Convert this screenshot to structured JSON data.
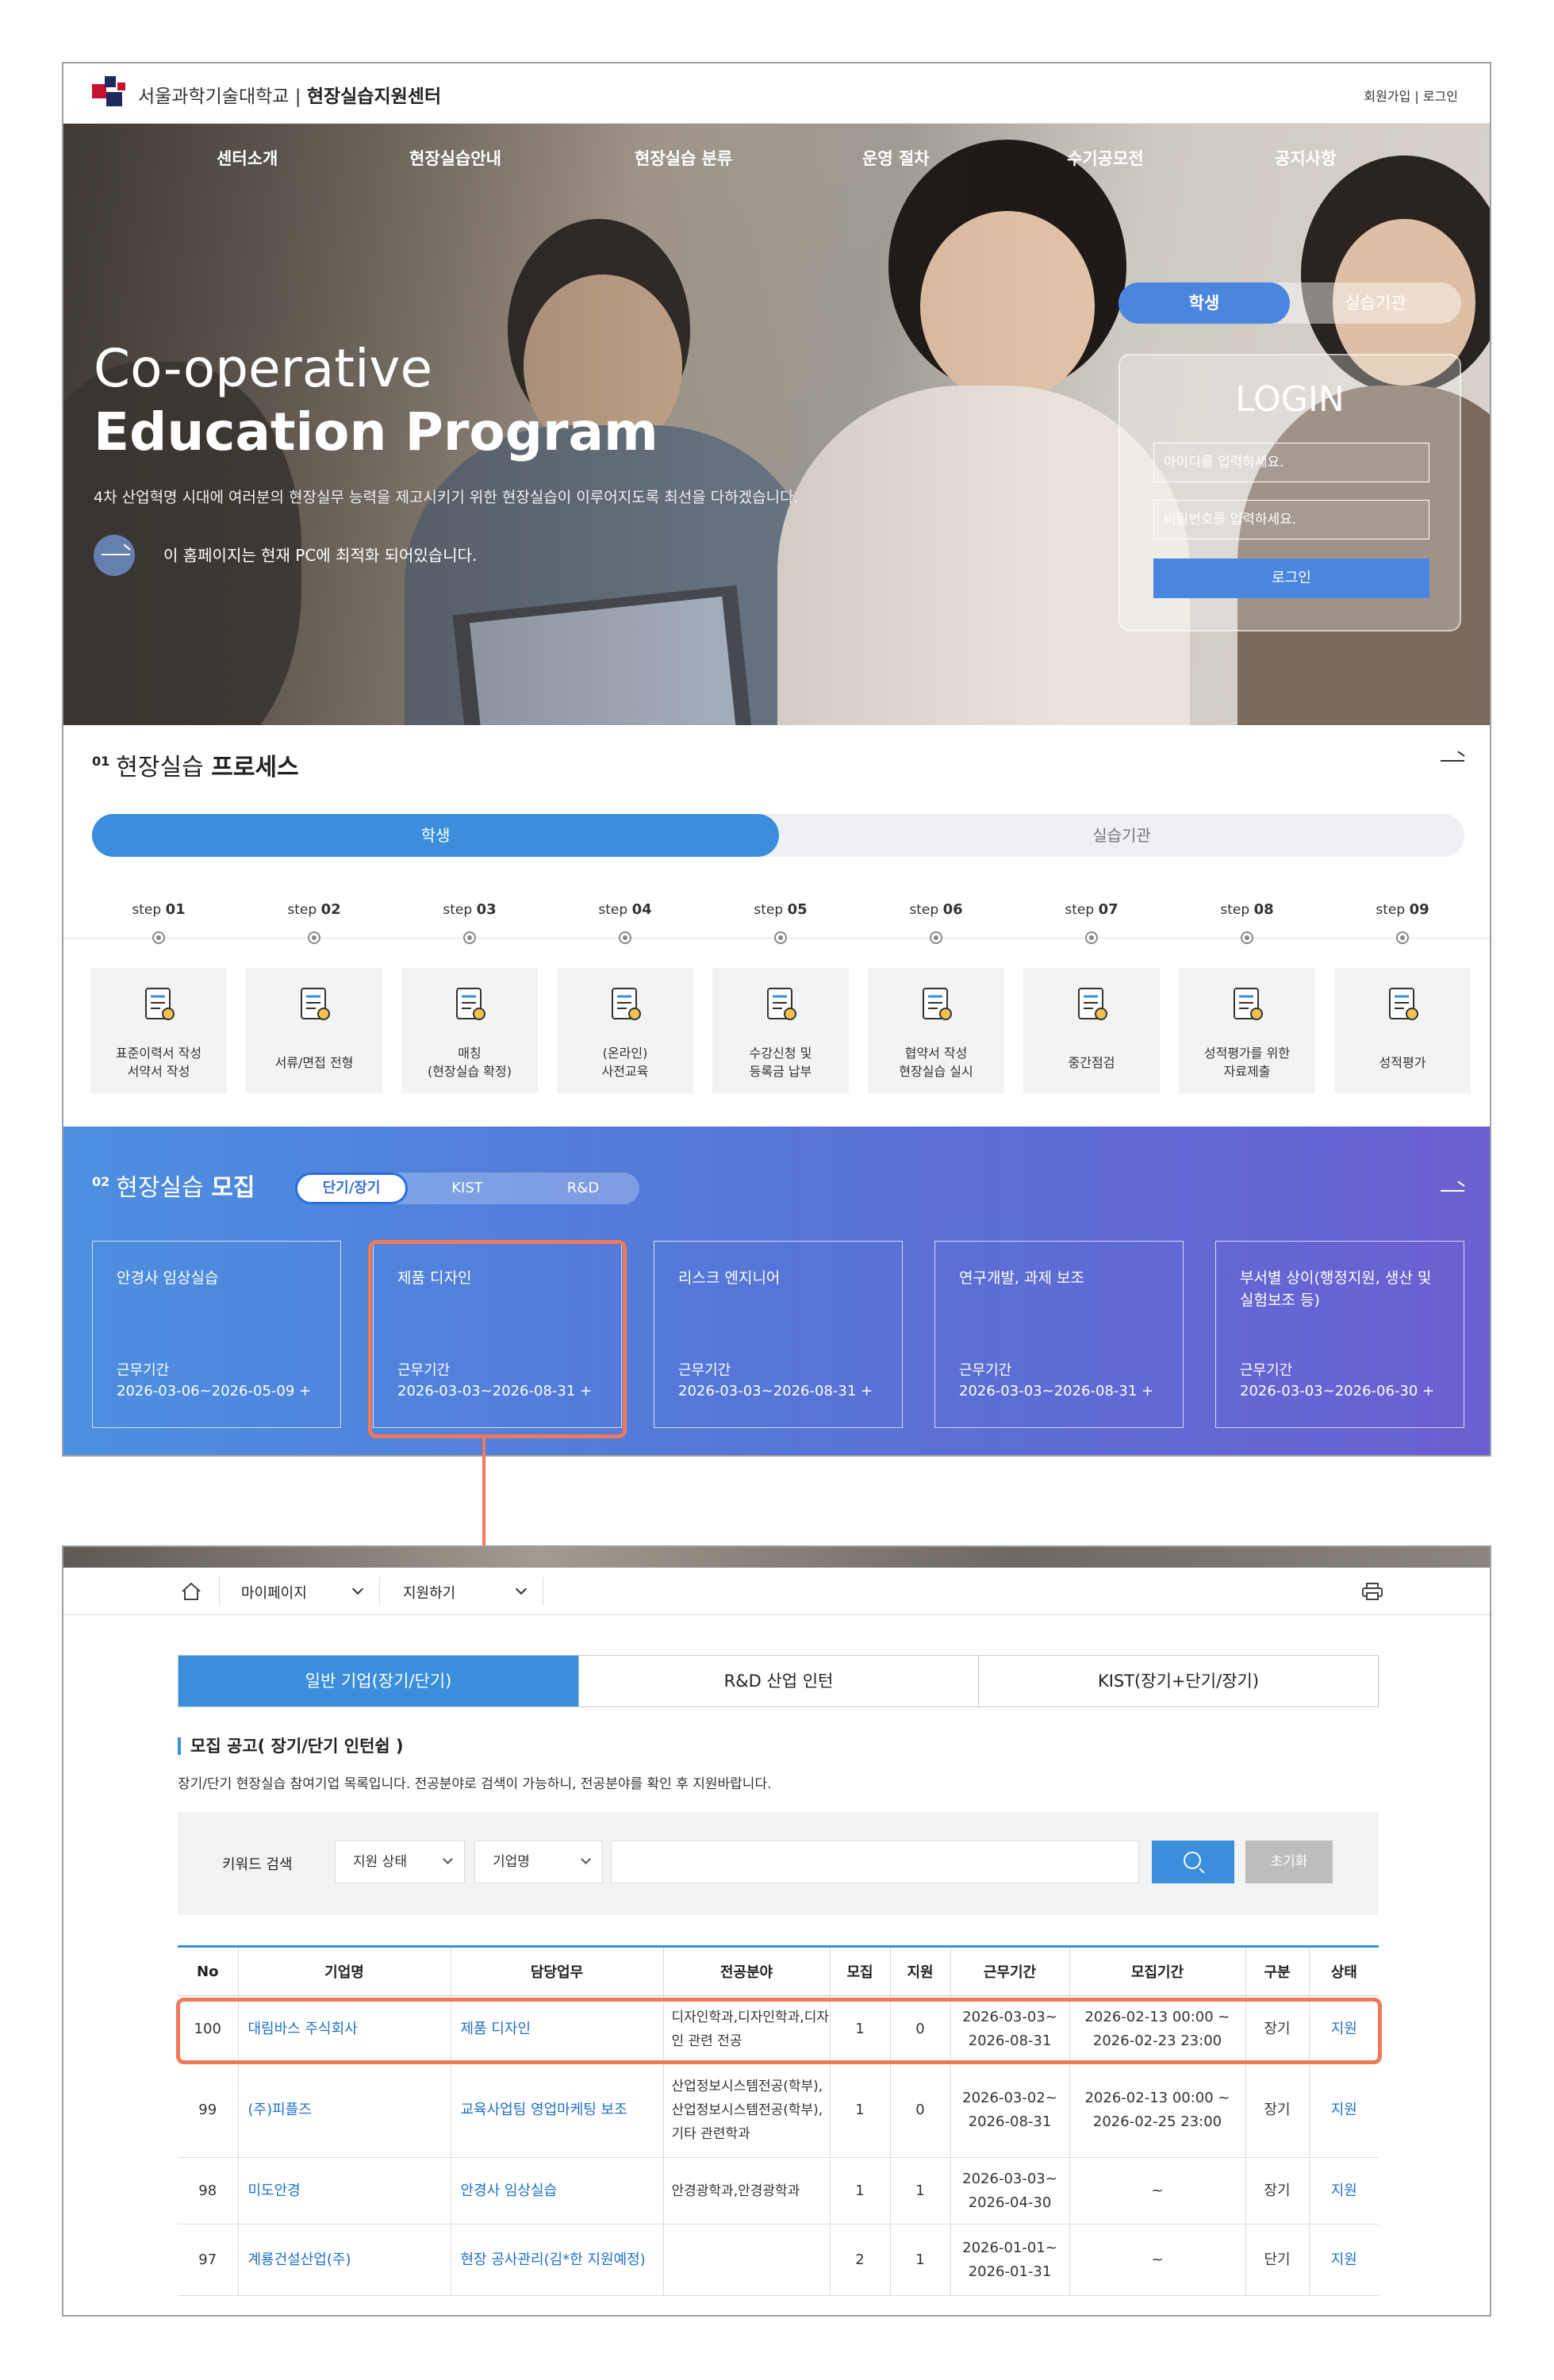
{
  "header": {
    "univ": "서울과학기술대학교",
    "center": "현장실습지원센터",
    "links": "회원가입 | 로그인"
  },
  "nav": [
    "센터소개",
    "현장실습안내",
    "현장실습 분류",
    "운영 절차",
    "수기공모전",
    "공지사항"
  ],
  "hero": {
    "title_line1": "Co-operative",
    "title_line2": "Education Program",
    "subtitle": "4차 산업혁명 시대에 여러분의 현장실무 능력을 제고시키기 위한 현장실습이 이루어지도록 최선을 다하겠습니다.",
    "note": "이 홈페이지는 현재 PC에 최적화 되어있습니다."
  },
  "login": {
    "tab_student": "학생",
    "tab_org": "실습기관",
    "title": "LOGIN",
    "id_placeholder": "아이디를 입력하세요.",
    "pw_placeholder": "비밀번호를 입력하세요.",
    "button": "로그인"
  },
  "process": {
    "num": "01",
    "title_light": "현장실습",
    "title_bold": "프로세스",
    "tab_student": "학생",
    "tab_org": "실습기관",
    "steps": [
      {
        "prefix": "step",
        "n": "01",
        "label1": "표준이력서 작성",
        "label2": "서약서 작성"
      },
      {
        "prefix": "step",
        "n": "02",
        "label1": "서류/면접 전형",
        "label2": ""
      },
      {
        "prefix": "step",
        "n": "03",
        "label1": "매칭",
        "label2": "(현장실습 확정)"
      },
      {
        "prefix": "step",
        "n": "04",
        "label1": "(온라인)",
        "label2": "사전교육"
      },
      {
        "prefix": "step",
        "n": "05",
        "label1": "수강신청 및",
        "label2": "등록금 납부"
      },
      {
        "prefix": "step",
        "n": "06",
        "label1": "협약서 작성",
        "label2": "현장실습 실시"
      },
      {
        "prefix": "step",
        "n": "07",
        "label1": "중간점검",
        "label2": ""
      },
      {
        "prefix": "step",
        "n": "08",
        "label1": "성적평가를 위한",
        "label2": "자료제출"
      },
      {
        "prefix": "step",
        "n": "09",
        "label1": "성적평가",
        "label2": ""
      }
    ]
  },
  "recruit": {
    "num": "02",
    "title_light": "현장실습",
    "title_bold": "모집",
    "tabs": [
      "단기/장기",
      "KIST",
      "R&D"
    ],
    "cards": [
      {
        "title": "안경사 임상실습",
        "period_label": "근무기간",
        "period": "2026-03-06~2026-05-09  +"
      },
      {
        "title": "제품 디자인",
        "period_label": "근무기간",
        "period": "2026-03-03~2026-08-31  +"
      },
      {
        "title": "리스크 엔지니어",
        "period_label": "근무기간",
        "period": "2026-03-03~2026-08-31  +"
      },
      {
        "title": "연구개발, 과제 보조",
        "period_label": "근무기간",
        "period": "2026-03-03~2026-08-31  +"
      },
      {
        "title": "부서별 상이(행정지원, 생산 및 실험보조 등)",
        "period_label": "근무기간",
        "period": "2026-03-03~2026-06-30  +"
      }
    ]
  },
  "page2": {
    "breadcrumb": [
      "마이페이지",
      "지원하기"
    ],
    "tabs": [
      "일반 기업(장기/단기)",
      "R&D 산업 인턴",
      "KIST(장기+단기/장기)"
    ],
    "section_title": "모집 공고( 장기/단기 인턴쉽 )",
    "section_desc": "장기/단기 현장실습 참여기업 목록입니다. 전공분야로 검색이 가능하니, 전공분야를 확인 후 지원바랍니다.",
    "search_label": "키워드 검색",
    "select_status": "지원 상태",
    "select_field": "기업명",
    "reset": "초기화",
    "columns": [
      "No",
      "기업명",
      "담당업무",
      "전공분야",
      "모집",
      "지원",
      "근무기간",
      "모집기간",
      "구분",
      "상태"
    ],
    "rows": [
      {
        "no": "100",
        "company": "대림바스 주식회사",
        "duty": "제품 디자인",
        "major": "디자인학과,디자인학과,디자인 관련 전공",
        "recruit": "1",
        "applied": "0",
        "work": "2026-03-03~ 2026-08-31",
        "period": "2026-02-13 00:00 ~ 2026-02-23 23:00",
        "type": "장기",
        "status": "지원"
      },
      {
        "no": "99",
        "company": "(주)피플즈",
        "duty": "교육사업팀 영업마케팅 보조",
        "major": "산업정보시스템전공(학부),산업정보시스템전공(학부),기타 관련학과",
        "recruit": "1",
        "applied": "0",
        "work": "2026-03-02~ 2026-08-31",
        "period": "2026-02-13 00:00 ~ 2026-02-25 23:00",
        "type": "장기",
        "status": "지원"
      },
      {
        "no": "98",
        "company": "미도안경",
        "duty": "안경사 임상실습",
        "major": "안경광학과,안경광학과",
        "recruit": "1",
        "applied": "1",
        "work": "2026-03-03~ 2026-04-30",
        "period": "~",
        "type": "장기",
        "status": "지원"
      },
      {
        "no": "97",
        "company": "계룡건설산업(주)",
        "duty": "현장 공사관리(김*한 지원예정)",
        "major": "",
        "recruit": "2",
        "applied": "1",
        "work": "2026-01-01~ 2026-01-31",
        "period": "~",
        "type": "단기",
        "status": "지원"
      }
    ]
  },
  "colors": {
    "accent": "#3b8edb",
    "highlight": "#ef7a5a",
    "link": "#1e6fc9"
  }
}
